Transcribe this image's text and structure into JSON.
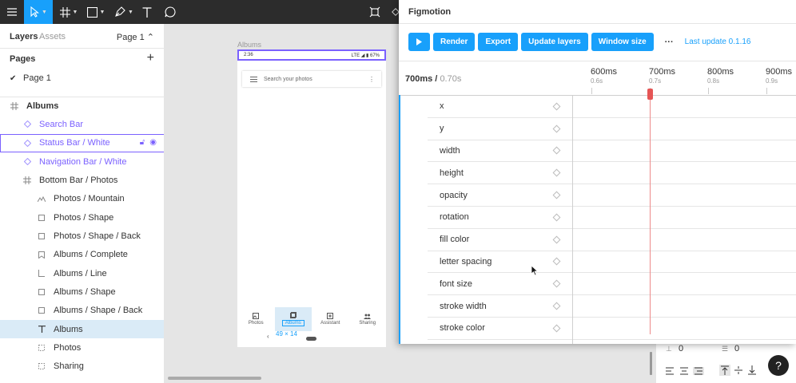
{
  "toolbar": {
    "tools": [
      "menu-icon",
      "move-tool",
      "frame-tool",
      "shape-tool",
      "pen-tool",
      "text-tool",
      "comment-tool"
    ],
    "right_tools": [
      "component-icon",
      "plugin-icon"
    ]
  },
  "left_panel": {
    "tab_layers": "Layers",
    "tab_assets": "Assets",
    "page_selector": "Page 1 ⌃",
    "pages_heading": "Pages",
    "pages": [
      "Page 1"
    ],
    "layers": [
      {
        "label": "Albums",
        "icon": "frame",
        "kind": "frame"
      },
      {
        "label": "Search Bar",
        "icon": "component-instance",
        "kind": "component"
      },
      {
        "label": "Status Bar / White",
        "icon": "component-instance",
        "kind": "component",
        "hovered": true
      },
      {
        "label": "Navigation Bar / White",
        "icon": "component-instance",
        "kind": "component"
      },
      {
        "label": "Bottom Bar / Photos",
        "icon": "frame",
        "kind": "frame"
      },
      {
        "label": "Photos / Mountain",
        "icon": "vector",
        "kind": "child"
      },
      {
        "label": "Photos / Shape",
        "icon": "rectangle",
        "kind": "child"
      },
      {
        "label": "Photos / Shape / Back",
        "icon": "rectangle",
        "kind": "child"
      },
      {
        "label": "Albums / Complete",
        "icon": "bookmark",
        "kind": "child"
      },
      {
        "label": "Albums / Line",
        "icon": "line",
        "kind": "child"
      },
      {
        "label": "Albums / Shape",
        "icon": "rectangle",
        "kind": "child"
      },
      {
        "label": "Albums / Shape / Back",
        "icon": "rectangle",
        "kind": "child"
      },
      {
        "label": "Albums",
        "icon": "text",
        "kind": "child",
        "selected": true
      },
      {
        "label": "Photos",
        "icon": "dashed-rect",
        "kind": "child"
      },
      {
        "label": "Sharing",
        "icon": "dashed-rect",
        "kind": "child"
      }
    ]
  },
  "canvas": {
    "frame_label": "Albums",
    "status_time": "2:36",
    "status_right": "LTE ◢ ▮ 67%",
    "search_placeholder": "Search your photos",
    "bottom_items": [
      "Photos",
      "Albums",
      "Assistant",
      "Sharing"
    ],
    "dimension_label": "49 × 14",
    "nav_back": "‹"
  },
  "right_panel": {
    "spacing_value_1": "0",
    "spacing_value_2": "0",
    "help_label": "?"
  },
  "plugin": {
    "title": "Figmotion",
    "play_icon": "play-icon",
    "buttons": [
      "Render",
      "Export",
      "Update layers",
      "Window size"
    ],
    "more": "···",
    "last_update": "Last update 0.1.16",
    "current_time": "700ms /",
    "total_time": "0.70s",
    "ticks": [
      {
        "ms": "600ms",
        "s": "0.6s"
      },
      {
        "ms": "700ms",
        "s": "0.7s"
      },
      {
        "ms": "800ms",
        "s": "0.8s"
      },
      {
        "ms": "900ms",
        "s": "0.9s"
      }
    ],
    "properties": [
      "x",
      "y",
      "width",
      "height",
      "opacity",
      "rotation",
      "fill color",
      "letter spacing",
      "font size",
      "stroke width",
      "stroke color"
    ],
    "colors": {
      "accent": "#18a0fb",
      "playhead": "#e55555",
      "component": "#7b61ff"
    }
  }
}
